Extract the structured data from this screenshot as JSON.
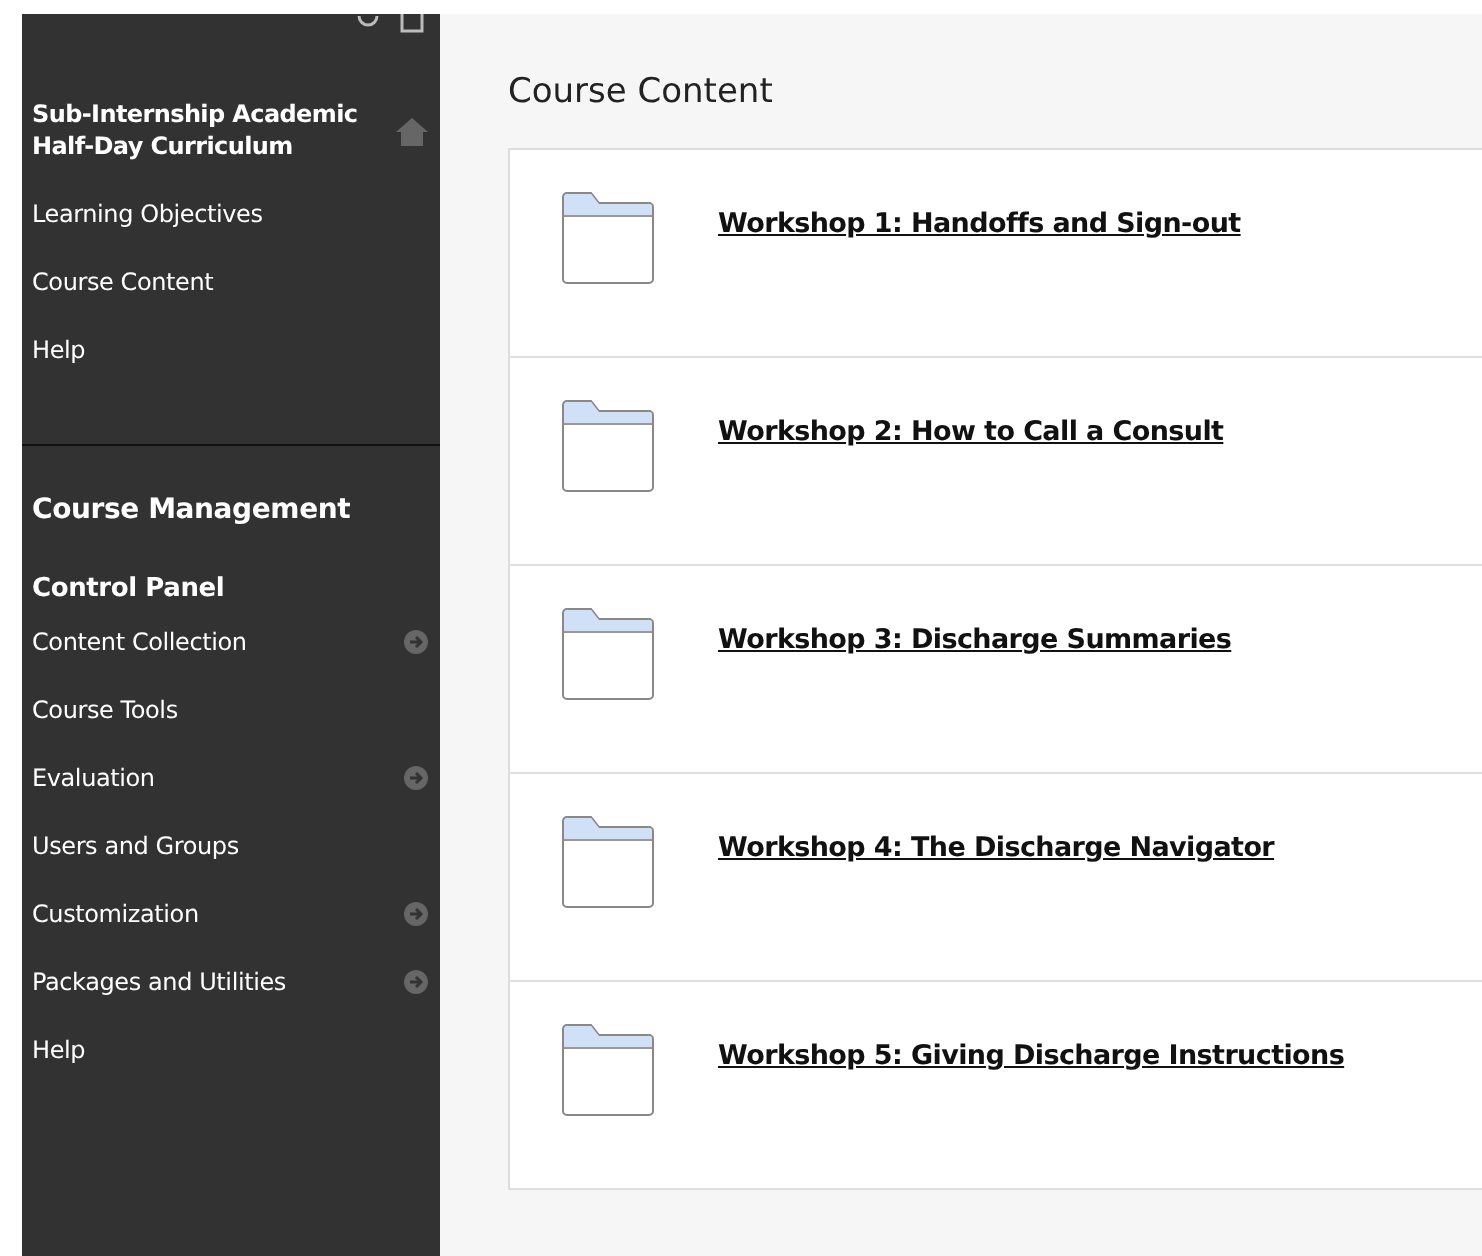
{
  "sidebar": {
    "course_title": "Sub-Internship Academic Half-Day Curriculum",
    "course_menu": [
      {
        "label": "Learning Objectives"
      },
      {
        "label": "Course Content"
      },
      {
        "label": "Help"
      }
    ],
    "management_title": "Course Management",
    "control_panel": {
      "title": "Control Panel",
      "items": [
        {
          "label": "Content Collection",
          "has_arrow": true
        },
        {
          "label": "Course Tools",
          "has_arrow": false
        },
        {
          "label": "Evaluation",
          "has_arrow": true
        },
        {
          "label": "Users and Groups",
          "has_arrow": false
        },
        {
          "label": "Customization",
          "has_arrow": true
        },
        {
          "label": "Packages and Utilities",
          "has_arrow": true
        },
        {
          "label": "Help",
          "has_arrow": false
        }
      ]
    }
  },
  "main": {
    "title": "Course Content",
    "items": [
      {
        "title": "Workshop 1: Handoffs and Sign-out"
      },
      {
        "title": "Workshop 2: How to Call a Consult"
      },
      {
        "title": "Workshop 3: Discharge Summaries"
      },
      {
        "title": "Workshop 4: The Discharge Navigator"
      },
      {
        "title": "Workshop 5: Giving Discharge Instructions"
      }
    ]
  }
}
